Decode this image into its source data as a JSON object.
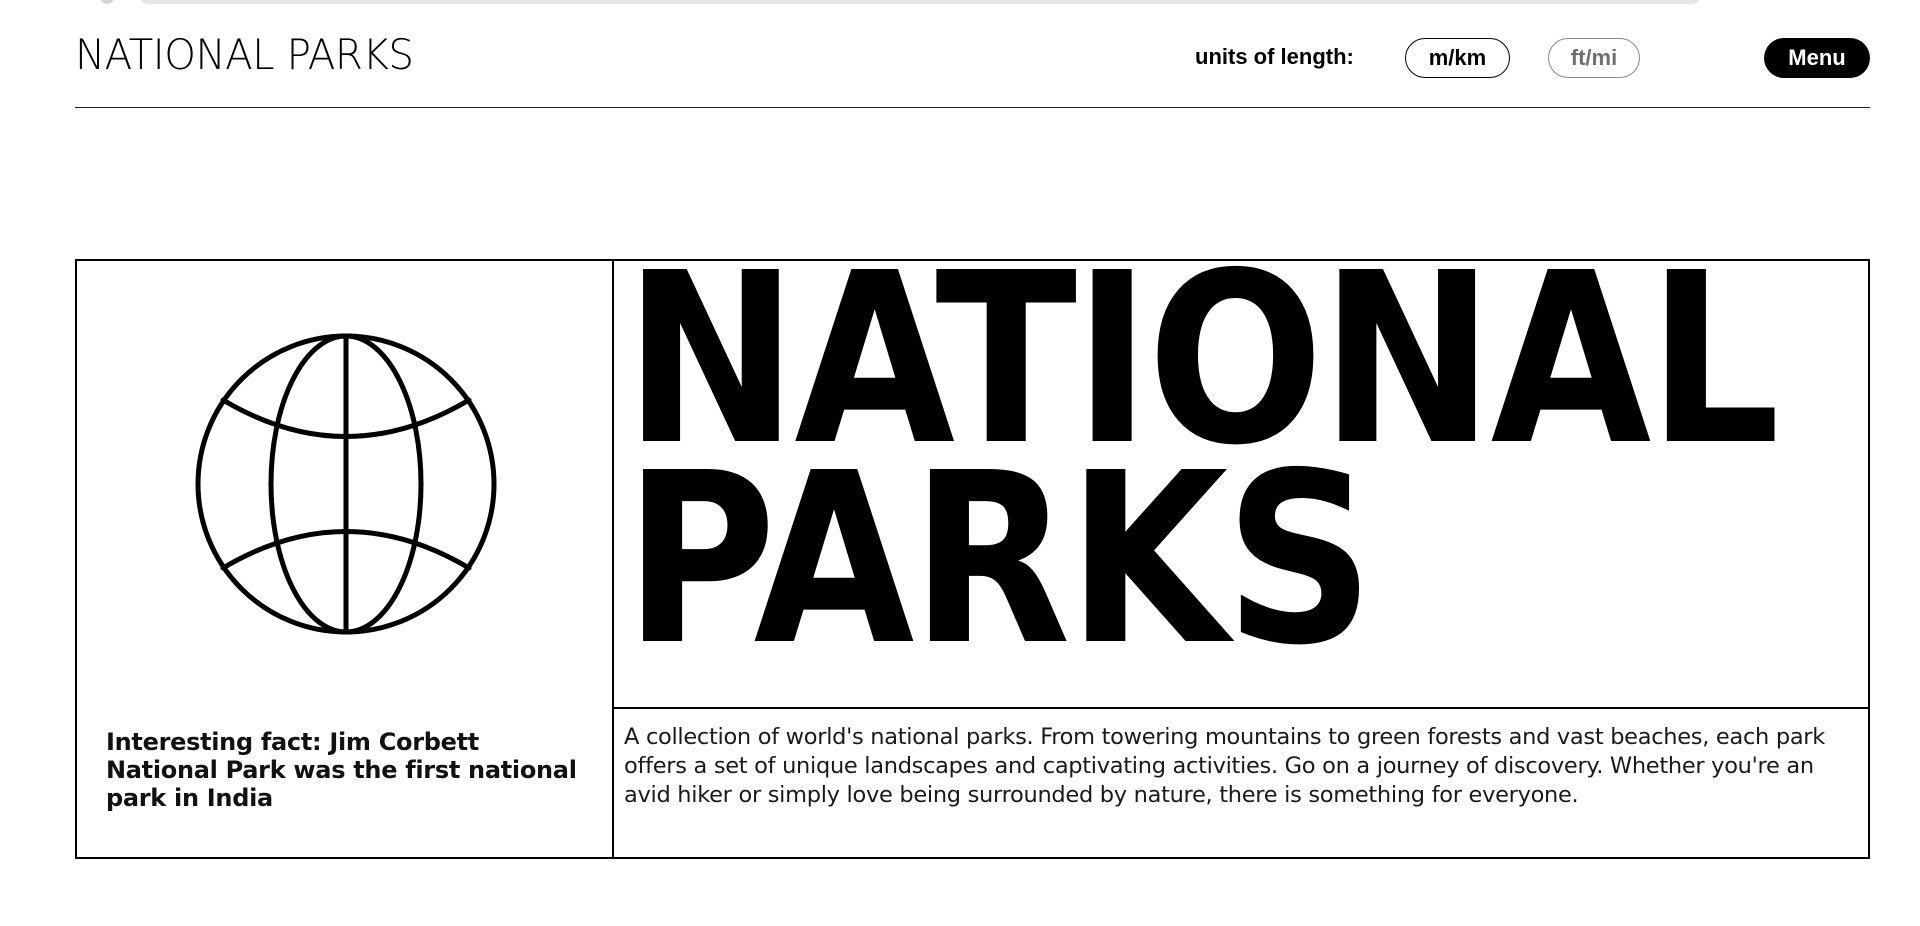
{
  "header": {
    "brand": "NATIONAL PARKS",
    "units_label": "units of length:",
    "units_options": [
      {
        "label": "m/km",
        "selected": true
      },
      {
        "label": "ft/mi",
        "selected": false
      }
    ],
    "menu_label": "Menu"
  },
  "hero": {
    "title_line_1": "NATIONAL",
    "title_line_2": "PARKS",
    "fact": "Interesting fact: Jim Corbett National Park was the first national park in India",
    "description": "A collection of world's national parks. From towering mountains to green forests and vast beaches, each park offers a set of unique landscapes and captivating activities. Go on a journey of discovery. Whether you're an avid hiker or simply love being surrounded by nature, there is something for everyone.",
    "icon": "globe-icon"
  },
  "colors": {
    "foreground": "#000000",
    "background": "#ffffff",
    "inactive": "#6f6f6f"
  }
}
